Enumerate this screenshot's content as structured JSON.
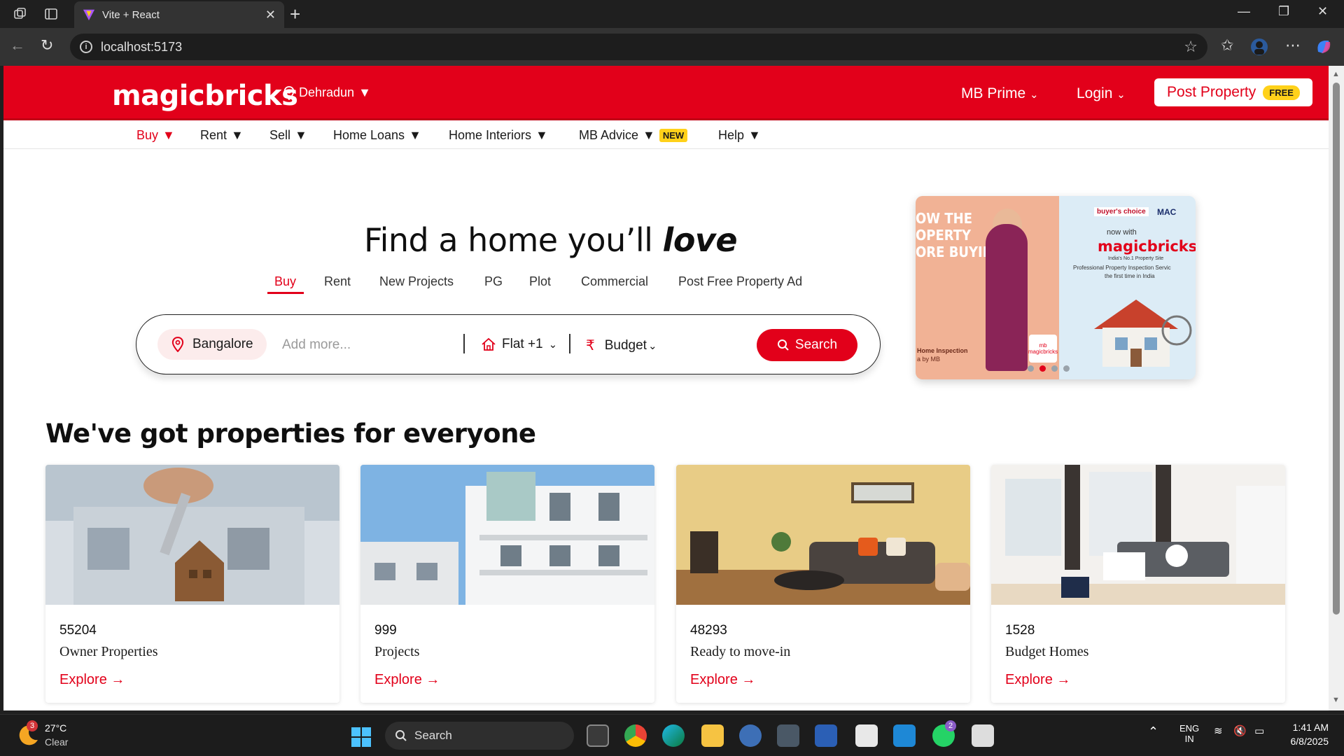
{
  "browser": {
    "tab_title": "Vite + React",
    "url": "localhost:5173"
  },
  "header": {
    "logo": "magicbricks",
    "city": "Dehradun",
    "mb_prime": "MB Prime",
    "login": "Login",
    "post_property": "Post Property",
    "free_badge": "FREE",
    "brand_color": "#e2001a"
  },
  "subnav": {
    "items": [
      {
        "label": "Buy",
        "active": true
      },
      {
        "label": "Rent"
      },
      {
        "label": "Sell"
      },
      {
        "label": "Home Loans"
      },
      {
        "label": "Home Interiors"
      },
      {
        "label": "MB Advice",
        "badge": "NEW"
      },
      {
        "label": "Help"
      }
    ]
  },
  "hero": {
    "title_main": "Find a home you’ll ",
    "title_em": "love",
    "tabs": [
      "Buy",
      "Rent",
      "New Projects",
      "PG",
      "Plot",
      "Commercial",
      "Post Free Property Ad"
    ],
    "active_tab": "Buy"
  },
  "search": {
    "location_chip": "Bangalore",
    "placeholder": "Add more...",
    "property_type": "Flat +1",
    "budget": "Budget",
    "button": "Search"
  },
  "banner": {
    "left_lines": [
      "OW THE",
      "OPERTY",
      "ORE BUYING!"
    ],
    "left_caption_1": "Home Inspection",
    "left_caption_2": "a by MB",
    "mb_square": "mb magicbricks",
    "buyers_choice": "buyer's choice",
    "mac": "MAC",
    "now_with": "now with",
    "brand": "magicbricks",
    "line1": "India's No.1 Property Site",
    "line2": "Professional Property Inspection Servic",
    "line3": "the first time in India",
    "slide_count": 4,
    "active_slide": 2
  },
  "properties": {
    "title": "We've got properties for everyone",
    "explore_label": "Explore →",
    "cards": [
      {
        "count": "55204",
        "label": "Owner Properties"
      },
      {
        "count": "999",
        "label": "Projects"
      },
      {
        "count": "48293",
        "label": "Ready to move-in"
      },
      {
        "count": "1528",
        "label": "Budget Homes"
      }
    ]
  },
  "taskbar": {
    "weather_badge": "3",
    "temperature": "27°C",
    "condition": "Clear",
    "search_label": "Search",
    "whatsapp_badge": "2",
    "lang_1": "ENG",
    "lang_2": "IN",
    "time": "1:41 AM",
    "date": "6/8/2025"
  }
}
